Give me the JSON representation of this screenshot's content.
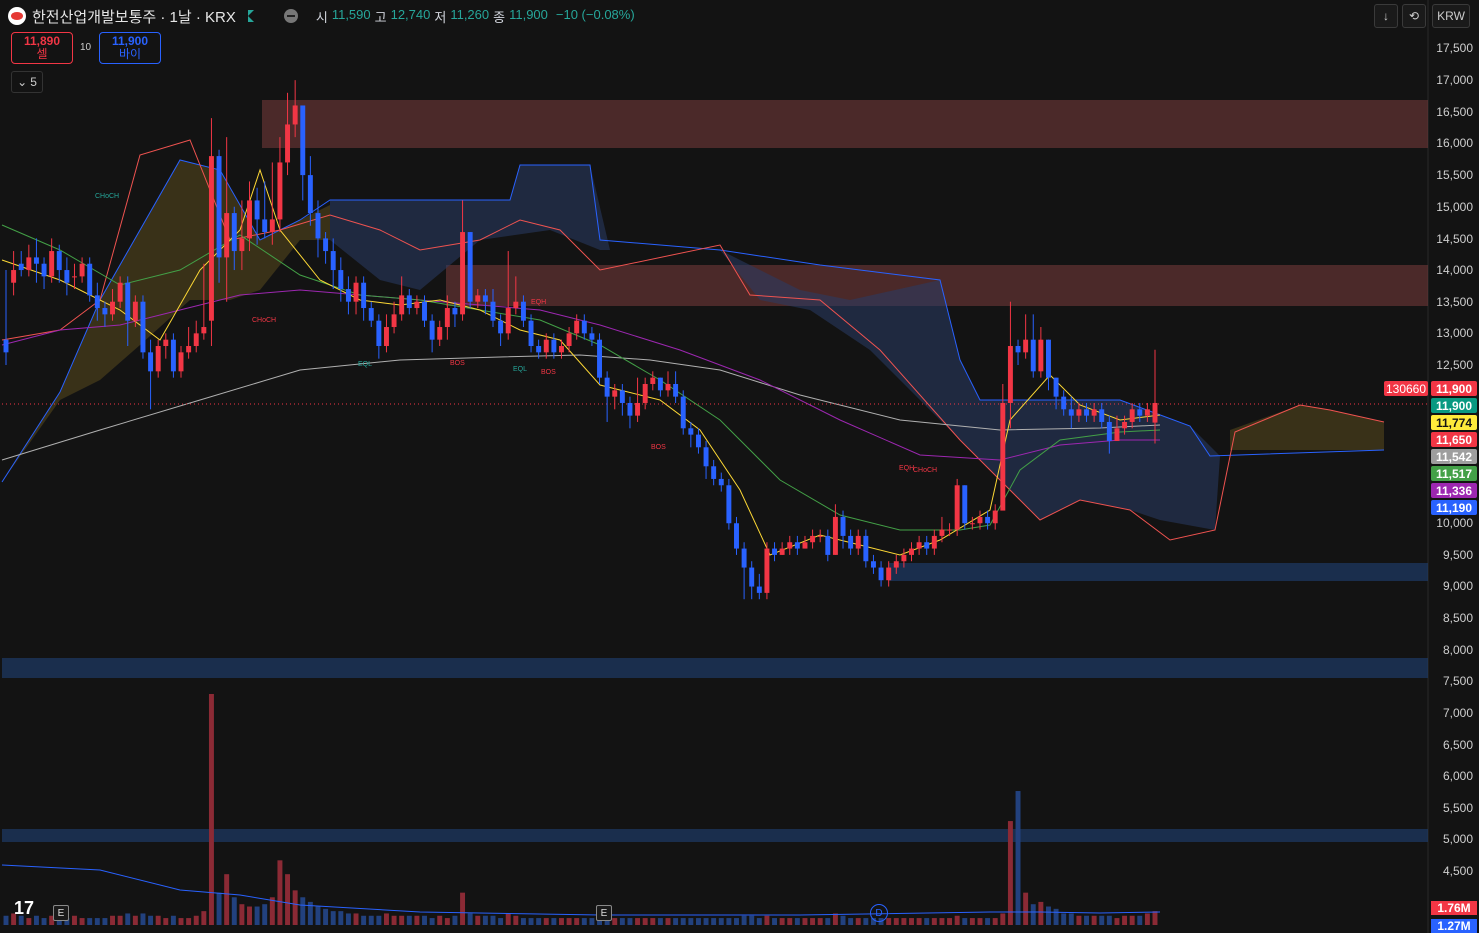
{
  "header": {
    "title": "한전산업개발보통주 · 1날 · KRX",
    "ohlc": [
      {
        "k": "시",
        "v": "11,590"
      },
      {
        "k": "고",
        "v": "12,740"
      },
      {
        "k": "저",
        "v": "11,260"
      },
      {
        "k": "종",
        "v": "11,900"
      }
    ],
    "change": "−10 (−0.08%)"
  },
  "toolbar": {
    "currency": "KRW",
    "download_icon": "↓",
    "refresh_icon": "⟲"
  },
  "trade": {
    "sell_price": "11,890",
    "sell_label": "셀",
    "buy_price": "11,900",
    "buy_label": "바이",
    "spread": "10"
  },
  "indicator_toggle": {
    "chevron": "⌄",
    "count": "5"
  },
  "price_axis": [
    "17,500",
    "17,000",
    "16,500",
    "16,000",
    "15,500",
    "15,000",
    "14,500",
    "14,000",
    "13,500",
    "13,000",
    "12,500",
    "10,000",
    "9,500",
    "9,000",
    "8,500",
    "8,000",
    "7,500",
    "7,000",
    "6,500",
    "6,000",
    "5,500",
    "5,000",
    "4,500"
  ],
  "price_tags": [
    {
      "text": "11,900",
      "bg": "#f23645",
      "fg": "#ffffff"
    },
    {
      "text": "11,900",
      "bg": "#089981",
      "fg": "#ffffff"
    },
    {
      "text": "11,774",
      "bg": "#ffeb3b",
      "fg": "#131313"
    },
    {
      "text": "11,650",
      "bg": "#f23645",
      "fg": "#ffffff"
    },
    {
      "text": "11,542",
      "bg": "#9e9e9e",
      "fg": "#ffffff"
    },
    {
      "text": "11,517",
      "bg": "#43a047",
      "fg": "#ffffff"
    },
    {
      "text": "11,336",
      "bg": "#9c27b0",
      "fg": "#ffffff"
    },
    {
      "text": "11,190",
      "bg": "#2962ff",
      "fg": "#ffffff"
    }
  ],
  "last_volume_label": "130660",
  "volume_tags": [
    {
      "text": "1.76M",
      "bg": "#f23645"
    },
    {
      "text": "1.27M",
      "bg": "#2962ff"
    }
  ],
  "smc_labels": [
    "CHoCH",
    "CHoCH",
    "EQL",
    "BOS",
    "EQL",
    "BOS",
    "EQH",
    "BOS",
    "EQH",
    "CHoCH"
  ],
  "events": {
    "earnings": "E",
    "dividend": "D"
  },
  "logo_text": "17",
  "colors": {
    "up": "#f23645",
    "down": "#2962ff",
    "background": "#131313"
  },
  "chart_data": {
    "type": "candlestick",
    "yrange": [
      4200,
      17800
    ],
    "candles": [
      [
        12900,
        12700,
        14000,
        12500
      ],
      [
        13800,
        14000,
        14300,
        13600
      ],
      [
        14100,
        14000,
        14300,
        13900
      ],
      [
        14000,
        14200,
        14400,
        13900
      ],
      [
        14200,
        14100,
        14500,
        13800
      ],
      [
        14100,
        13900,
        14200,
        13700
      ],
      [
        13900,
        14300,
        14500,
        13800
      ],
      [
        14300,
        14000,
        14400,
        13800
      ],
      [
        14000,
        13800,
        14200,
        13600
      ],
      [
        13900,
        13900,
        14100,
        13700
      ],
      [
        13900,
        14100,
        14200,
        13800
      ],
      [
        14100,
        13600,
        14200,
        13500
      ],
      [
        13600,
        13400,
        13800,
        13200
      ],
      [
        13400,
        13300,
        13500,
        13100
      ],
      [
        13300,
        13500,
        13700,
        13200
      ],
      [
        13500,
        13800,
        13900,
        13400
      ],
      [
        13800,
        13200,
        13900,
        12800
      ],
      [
        13200,
        13500,
        13600,
        13100
      ],
      [
        13500,
        12700,
        13600,
        12600
      ],
      [
        12700,
        12400,
        12900,
        11800
      ],
      [
        12400,
        12800,
        12900,
        12300
      ],
      [
        12800,
        12900,
        13000,
        12600
      ],
      [
        12900,
        12400,
        13000,
        12300
      ],
      [
        12400,
        12700,
        12800,
        12300
      ],
      [
        12700,
        12800,
        13100,
        12600
      ],
      [
        12800,
        13000,
        13200,
        12700
      ],
      [
        13000,
        13100,
        14100,
        12900
      ],
      [
        13200,
        15800,
        16400,
        12800
      ],
      [
        15800,
        14200,
        15900,
        13800
      ],
      [
        14200,
        14900,
        16100,
        13500
      ],
      [
        14900,
        14300,
        15000,
        14000
      ],
      [
        14300,
        14500,
        15100,
        14000
      ],
      [
        14500,
        15100,
        15400,
        14300
      ],
      [
        15100,
        14800,
        15300,
        14400
      ],
      [
        14800,
        14600,
        15400,
        14500
      ],
      [
        14600,
        14800,
        15700,
        14400
      ],
      [
        14800,
        15700,
        16100,
        14600
      ],
      [
        15700,
        16300,
        16800,
        15500
      ],
      [
        16300,
        16600,
        17000,
        16100
      ],
      [
        16600,
        15500,
        16600,
        15100
      ],
      [
        15500,
        14900,
        15800,
        14700
      ],
      [
        14900,
        14500,
        15100,
        14200
      ],
      [
        14500,
        14300,
        14600,
        14100
      ],
      [
        14300,
        14000,
        14500,
        13700
      ],
      [
        14000,
        13700,
        14200,
        13500
      ],
      [
        13700,
        13500,
        13900,
        13300
      ],
      [
        13500,
        13800,
        13900,
        13300
      ],
      [
        13800,
        13400,
        13900,
        13200
      ],
      [
        13400,
        13200,
        13500,
        13100
      ],
      [
        13200,
        12800,
        13300,
        12600
      ],
      [
        12800,
        13100,
        13300,
        12700
      ],
      [
        13100,
        13300,
        13500,
        13000
      ],
      [
        13300,
        13600,
        13900,
        13200
      ],
      [
        13600,
        13400,
        13700,
        13300
      ],
      [
        13400,
        13500,
        13600,
        13300
      ],
      [
        13500,
        13200,
        13600,
        13100
      ],
      [
        13200,
        12900,
        13300,
        12700
      ],
      [
        12900,
        13100,
        13200,
        12800
      ],
      [
        13100,
        13400,
        13600,
        12900
      ],
      [
        13400,
        13300,
        13500,
        13100
      ],
      [
        13300,
        14600,
        15100,
        13200
      ],
      [
        14600,
        13500,
        14600,
        13400
      ],
      [
        13500,
        13600,
        13700,
        13400
      ],
      [
        13600,
        13500,
        13700,
        13300
      ],
      [
        13500,
        13200,
        13700,
        13100
      ],
      [
        13200,
        13000,
        13300,
        12800
      ],
      [
        13000,
        13400,
        14300,
        12900
      ],
      [
        13400,
        13500,
        13900,
        13300
      ],
      [
        13500,
        13200,
        13600,
        13100
      ],
      [
        13200,
        12800,
        13300,
        12700
      ],
      [
        12800,
        12700,
        12900,
        12600
      ],
      [
        12700,
        12900,
        13000,
        12600
      ],
      [
        12900,
        12700,
        13000,
        12600
      ],
      [
        12700,
        12800,
        12900,
        12600
      ],
      [
        12800,
        13000,
        13100,
        12700
      ],
      [
        13000,
        13200,
        13300,
        12900
      ],
      [
        13200,
        13000,
        13300,
        12900
      ],
      [
        13000,
        12900,
        13100,
        12800
      ],
      [
        12900,
        12300,
        13000,
        12200
      ],
      [
        12300,
        12000,
        12400,
        11600
      ],
      [
        12000,
        12100,
        12200,
        11800
      ],
      [
        12100,
        11900,
        12200,
        11700
      ],
      [
        11900,
        11700,
        12000,
        11500
      ],
      [
        11700,
        11900,
        12300,
        11600
      ],
      [
        11900,
        12200,
        12300,
        11800
      ],
      [
        12200,
        12300,
        12400,
        12100
      ],
      [
        12300,
        12100,
        12300,
        12000
      ],
      [
        12100,
        12200,
        12400,
        12000
      ],
      [
        12200,
        12000,
        12400,
        11900
      ],
      [
        12000,
        11500,
        12100,
        11400
      ],
      [
        11500,
        11400,
        11600,
        11200
      ],
      [
        11400,
        11200,
        11500,
        11100
      ],
      [
        11200,
        10900,
        11300,
        10700
      ],
      [
        10900,
        10700,
        11000,
        10600
      ],
      [
        10700,
        10600,
        10800,
        10500
      ],
      [
        10600,
        10000,
        10700,
        9900
      ],
      [
        10000,
        9600,
        10100,
        9500
      ],
      [
        9600,
        9300,
        9700,
        8800
      ],
      [
        9300,
        9000,
        9400,
        8800
      ],
      [
        9000,
        8900,
        9200,
        8800
      ],
      [
        8900,
        9600,
        9700,
        8800
      ],
      [
        9600,
        9500,
        9700,
        9400
      ],
      [
        9500,
        9600,
        9700,
        9500
      ],
      [
        9600,
        9700,
        9800,
        9500
      ],
      [
        9700,
        9600,
        9800,
        9500
      ],
      [
        9600,
        9700,
        9800,
        9600
      ],
      [
        9700,
        9800,
        9900,
        9600
      ],
      [
        9800,
        9800,
        9900,
        9700
      ],
      [
        9800,
        9500,
        9900,
        9400
      ],
      [
        9500,
        10100,
        10300,
        9500
      ],
      [
        10100,
        9800,
        10200,
        9600
      ],
      [
        9800,
        9600,
        9900,
        9500
      ],
      [
        9600,
        9800,
        9900,
        9500
      ],
      [
        9800,
        9400,
        9900,
        9300
      ],
      [
        9400,
        9300,
        9500,
        9200
      ],
      [
        9300,
        9100,
        9400,
        9000
      ],
      [
        9100,
        9300,
        9400,
        9000
      ],
      [
        9300,
        9400,
        9500,
        9200
      ],
      [
        9400,
        9500,
        9600,
        9300
      ],
      [
        9500,
        9600,
        9700,
        9400
      ],
      [
        9600,
        9700,
        9800,
        9500
      ],
      [
        9700,
        9600,
        9800,
        9500
      ],
      [
        9600,
        9800,
        9900,
        9500
      ],
      [
        9800,
        9900,
        10100,
        9700
      ],
      [
        9900,
        9900,
        10000,
        9800
      ],
      [
        9900,
        10600,
        10700,
        9800
      ],
      [
        10600,
        10000,
        10600,
        9900
      ],
      [
        10000,
        10000,
        10100,
        9900
      ],
      [
        10000,
        10100,
        10200,
        9900
      ],
      [
        10100,
        10000,
        10200,
        9900
      ],
      [
        10000,
        10200,
        10300,
        9900
      ],
      [
        10200,
        11900,
        12200,
        11200
      ],
      [
        11900,
        12800,
        13500,
        11500
      ],
      [
        12800,
        12700,
        12900,
        12500
      ],
      [
        12700,
        12900,
        13300,
        12600
      ],
      [
        12900,
        12400,
        13300,
        12300
      ],
      [
        12400,
        12900,
        13100,
        12300
      ],
      [
        12900,
        12300,
        12900,
        12100
      ],
      [
        12300,
        12000,
        12300,
        11800
      ],
      [
        12000,
        11800,
        12100,
        11700
      ],
      [
        11800,
        11700,
        12000,
        11500
      ],
      [
        11700,
        11800,
        11900,
        11600
      ],
      [
        11800,
        11700,
        11900,
        11600
      ],
      [
        11700,
        11800,
        11900,
        11600
      ],
      [
        11800,
        11600,
        11900,
        11500
      ],
      [
        11600,
        11300,
        11700,
        11100
      ],
      [
        11300,
        11500,
        11700,
        11300
      ],
      [
        11500,
        11600,
        11700,
        11400
      ],
      [
        11600,
        11800,
        11900,
        11500
      ],
      [
        11800,
        11700,
        11900,
        11600
      ],
      [
        11700,
        11800,
        11900,
        11600
      ],
      [
        11590,
        11900,
        12740,
        11260
      ]
    ],
    "volume_pct": [
      4,
      5,
      4,
      3,
      4,
      3,
      4,
      3,
      3,
      4,
      3,
      3,
      3,
      3,
      4,
      4,
      5,
      4,
      5,
      4,
      4,
      3,
      4,
      3,
      3,
      4,
      6,
      100,
      14,
      22,
      12,
      9,
      8,
      8,
      9,
      12,
      28,
      22,
      15,
      12,
      10,
      8,
      7,
      6,
      6,
      5,
      5,
      4,
      4,
      4,
      5,
      4,
      4,
      4,
      4,
      4,
      3,
      4,
      3,
      4,
      14,
      5,
      4,
      4,
      4,
      3,
      5,
      4,
      3,
      3,
      3,
      3,
      3,
      3,
      3,
      3,
      3,
      3,
      4,
      4,
      3,
      3,
      3,
      3,
      3,
      3,
      3,
      3,
      3,
      3,
      3,
      3,
      3,
      3,
      3,
      3,
      3,
      4,
      4,
      3,
      4,
      3,
      3,
      3,
      3,
      3,
      3,
      3,
      3,
      5,
      4,
      3,
      3,
      3,
      3,
      3,
      3,
      3,
      3,
      3,
      3,
      3,
      3,
      3,
      3,
      4,
      3,
      3,
      3,
      3,
      3,
      5,
      45,
      58,
      14,
      9,
      10,
      8,
      7,
      5,
      5,
      4,
      4,
      4,
      4,
      4,
      3,
      4,
      4,
      4,
      5,
      6
    ]
  }
}
